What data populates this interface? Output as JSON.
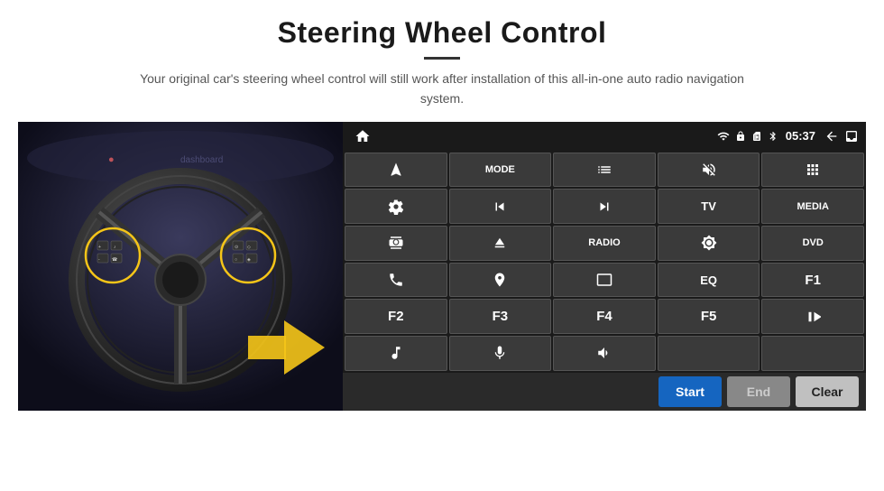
{
  "header": {
    "title": "Steering Wheel Control",
    "subtitle": "Your original car's steering wheel control will still work after installation of this all-in-one auto radio navigation system."
  },
  "status_bar": {
    "time": "05:37",
    "wifi_icon": "wifi",
    "lock_icon": "lock",
    "sim_icon": "sim",
    "bt_icon": "bluetooth",
    "back_icon": "back",
    "home_icon": "home"
  },
  "buttons": [
    {
      "id": "btn-nav",
      "label": "",
      "icon": "navigate",
      "row": 1,
      "col": 1
    },
    {
      "id": "btn-mode",
      "label": "MODE",
      "icon": "",
      "row": 1,
      "col": 2
    },
    {
      "id": "btn-list",
      "label": "",
      "icon": "list",
      "row": 1,
      "col": 3
    },
    {
      "id": "btn-mute",
      "label": "",
      "icon": "mute",
      "row": 1,
      "col": 4
    },
    {
      "id": "btn-apps",
      "label": "",
      "icon": "apps",
      "row": 1,
      "col": 5
    },
    {
      "id": "btn-settings",
      "label": "",
      "icon": "settings",
      "row": 2,
      "col": 1
    },
    {
      "id": "btn-prev",
      "label": "",
      "icon": "prev",
      "row": 2,
      "col": 2
    },
    {
      "id": "btn-next",
      "label": "",
      "icon": "next",
      "row": 2,
      "col": 3
    },
    {
      "id": "btn-tv",
      "label": "TV",
      "icon": "",
      "row": 2,
      "col": 4
    },
    {
      "id": "btn-media",
      "label": "MEDIA",
      "icon": "",
      "row": 2,
      "col": 5
    },
    {
      "id": "btn-360",
      "label": "",
      "icon": "360-cam",
      "row": 3,
      "col": 1
    },
    {
      "id": "btn-eject",
      "label": "",
      "icon": "eject",
      "row": 3,
      "col": 2
    },
    {
      "id": "btn-radio",
      "label": "RADIO",
      "icon": "",
      "row": 3,
      "col": 3
    },
    {
      "id": "btn-brightness",
      "label": "",
      "icon": "brightness",
      "row": 3,
      "col": 4
    },
    {
      "id": "btn-dvd",
      "label": "DVD",
      "icon": "",
      "row": 3,
      "col": 5
    },
    {
      "id": "btn-phone",
      "label": "",
      "icon": "phone",
      "row": 4,
      "col": 1
    },
    {
      "id": "btn-gps",
      "label": "",
      "icon": "gps",
      "row": 4,
      "col": 2
    },
    {
      "id": "btn-screen",
      "label": "",
      "icon": "screen",
      "row": 4,
      "col": 3
    },
    {
      "id": "btn-eq",
      "label": "EQ",
      "icon": "",
      "row": 4,
      "col": 4
    },
    {
      "id": "btn-f1",
      "label": "F1",
      "icon": "",
      "row": 4,
      "col": 5
    },
    {
      "id": "btn-f2",
      "label": "F2",
      "icon": "",
      "row": 5,
      "col": 1
    },
    {
      "id": "btn-f3",
      "label": "F3",
      "icon": "",
      "row": 5,
      "col": 2
    },
    {
      "id": "btn-f4",
      "label": "F4",
      "icon": "",
      "row": 5,
      "col": 3
    },
    {
      "id": "btn-f5",
      "label": "F5",
      "icon": "",
      "row": 5,
      "col": 4
    },
    {
      "id": "btn-playpause",
      "label": "",
      "icon": "play-pause",
      "row": 5,
      "col": 5
    },
    {
      "id": "btn-music",
      "label": "",
      "icon": "music",
      "row": 6,
      "col": 1
    },
    {
      "id": "btn-mic",
      "label": "",
      "icon": "mic",
      "row": 6,
      "col": 2
    },
    {
      "id": "btn-vol-call",
      "label": "",
      "icon": "vol-call",
      "row": 6,
      "col": 3
    },
    {
      "id": "btn-empty1",
      "label": "",
      "icon": "",
      "row": 6,
      "col": 4
    },
    {
      "id": "btn-empty2",
      "label": "",
      "icon": "",
      "row": 6,
      "col": 5
    }
  ],
  "action_buttons": {
    "start_label": "Start",
    "end_label": "End",
    "clear_label": "Clear"
  },
  "colors": {
    "start_bg": "#1565C0",
    "end_bg": "#888888",
    "clear_bg": "#c0c0c0"
  }
}
